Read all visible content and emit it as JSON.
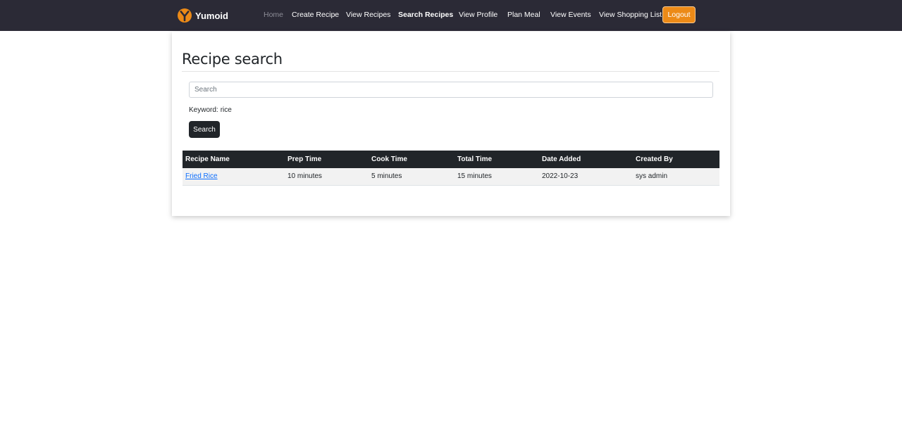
{
  "app": {
    "brand_name": "Yumoid",
    "brand_icon": "yumoid-logo-icon",
    "brand_color": "#ec8a17"
  },
  "nav": {
    "items": [
      {
        "label": "Home",
        "name": "nav-home"
      },
      {
        "label": "Create Recipe",
        "name": "nav-create-recipe"
      },
      {
        "label": "View Recipes",
        "name": "nav-view-recipes"
      },
      {
        "label": "Search Recipes",
        "name": "nav-search-recipes",
        "active": true
      },
      {
        "label": "View Profile",
        "name": "nav-view-profile"
      },
      {
        "label": "Plan Meal",
        "name": "nav-plan-meal"
      },
      {
        "label": "View Events",
        "name": "nav-view-events"
      },
      {
        "label": "View Shopping List",
        "name": "nav-view-shopping-list"
      }
    ],
    "logout_label": "Logout"
  },
  "main": {
    "title": "Recipe search",
    "search": {
      "placeholder": "Search",
      "value": ""
    },
    "keyword_label": "Keyword:",
    "keyword_value": "rice",
    "search_button_label": "Search"
  },
  "table": {
    "columns": [
      "Recipe Name",
      "Prep Time",
      "Cook Time",
      "Total Time",
      "Date Added",
      "Created By"
    ],
    "rows": [
      {
        "recipe_name": "Fried Rice",
        "prep_time": "10 minutes",
        "cook_time": "5 minutes",
        "total_time": "15 minutes",
        "date_added": "2022-10-23",
        "created_by": "sys admin"
      }
    ]
  },
  "colors": {
    "navbar_bg": "#2b2a36",
    "accent": "#ec8a17",
    "table_header_bg": "#212529",
    "link": "#0d6efd"
  }
}
